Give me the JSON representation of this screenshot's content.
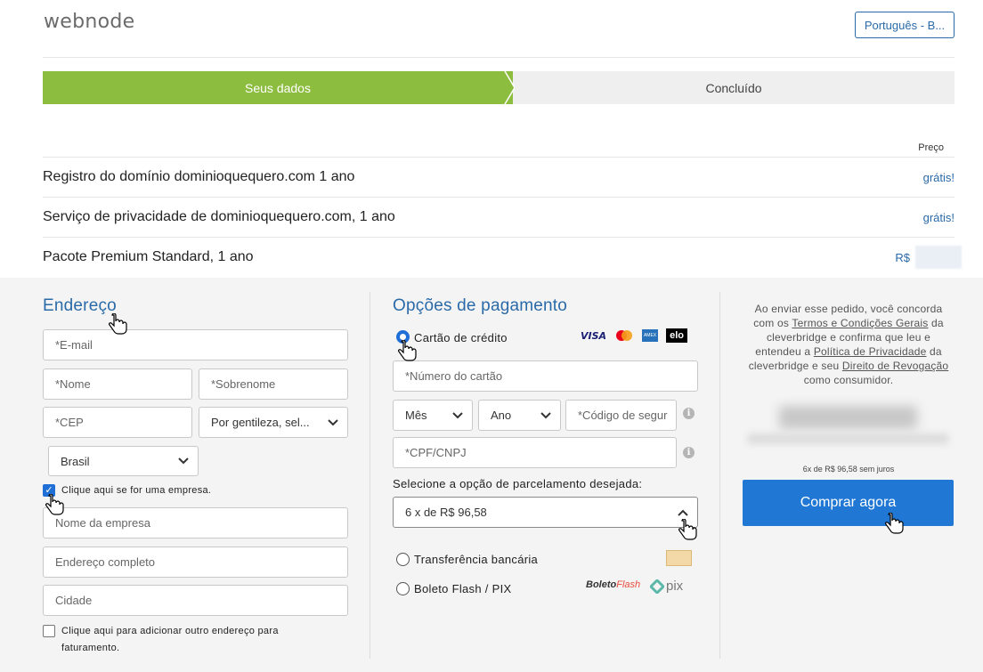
{
  "header": {
    "logo": "webnode",
    "language": "Português - B..."
  },
  "steps": {
    "active": "Seus dados",
    "next": "Concluído"
  },
  "order": {
    "price_header": "Preço",
    "items": [
      {
        "label": "Registro do domínio dominioquequero.com 1 ano",
        "price": "grátis!"
      },
      {
        "label": "Serviço de privacidade de dominioquequero.com, 1 ano",
        "price": "grátis!"
      },
      {
        "label": "Pacote Premium Standard, 1 ano",
        "price": "R$"
      }
    ]
  },
  "address": {
    "title": "Endereço",
    "email_placeholder": "*E-mail",
    "first_name_placeholder": "*Nome",
    "last_name_placeholder": "*Sobrenome",
    "zip_placeholder": "*CEP",
    "state_select": "Por gentileza, sel...",
    "country_select": "Brasil",
    "company_checkbox_label": "Clique aqui se for uma empresa.",
    "company_name_placeholder": "Nome da empresa",
    "full_address_placeholder": "Endereço completo",
    "city_placeholder": "Cidade",
    "billing_checkbox_line1": "Clique aqui para adicionar outro endereço para",
    "billing_checkbox_line2": "faturamento."
  },
  "payment": {
    "title": "Opções de pagamento",
    "credit_card_label": "Cartão de crédito",
    "card_number_placeholder": "*Número do cartão",
    "month_select": "Mês",
    "year_select": "Ano",
    "security_code_placeholder": "*Código de segur",
    "cpf_placeholder": "*CPF/CNPJ",
    "installment_label": "Selecione a opção de parcelamento desejada:",
    "installment_value": "6 x de R$ 96,58",
    "bank_transfer_label": "Transferência bancária",
    "boleto_label": "Boleto Flash / PIX",
    "card_brands": [
      "VISA",
      "mastercard",
      "AMEX",
      "elo"
    ],
    "boleto_logo_a": "Boleto",
    "boleto_logo_b": "Flash",
    "pix_logo": "pix"
  },
  "summary": {
    "terms_1": "Ao enviar esse pedido, você concorda com os ",
    "terms_link_1": "Termos e Condições Gerais",
    "terms_2": " da cleverbridge e confirma que leu e entendeu a ",
    "terms_link_2": "Política de Privacidade",
    "terms_3": " da cleverbridge e seu ",
    "terms_link_3": "Direito de Revogação",
    "terms_4": " como consumidor.",
    "installment_note": "6x de R$ 96,58 sem juros",
    "buy_button": "Comprar agora"
  },
  "colors": {
    "accent": "#2a6aa8",
    "step_active": "#8dbd3f",
    "buy_button": "#2178d4"
  }
}
